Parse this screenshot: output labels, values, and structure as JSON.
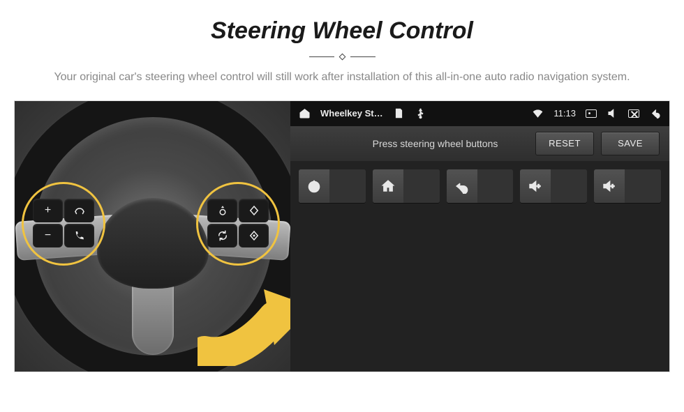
{
  "header": {
    "title": "Steering Wheel Control",
    "subtitle": "Your original car's steering wheel control will still work after installation of this all-in-one auto radio navigation system."
  },
  "wheel": {
    "left_pad_buttons": [
      "plus",
      "voice",
      "minus",
      "phone"
    ],
    "right_pad_buttons": [
      "wheel-up",
      "diamond",
      "cycle",
      "diamond-alt"
    ]
  },
  "statusbar": {
    "app_title": "Wheelkey St…",
    "time": "11:13"
  },
  "toolbar": {
    "instruction": "Press steering wheel buttons",
    "reset_label": "RESET",
    "save_label": "SAVE"
  },
  "tiles": [
    {
      "icon": "power"
    },
    {
      "icon": "home"
    },
    {
      "icon": "undo"
    },
    {
      "icon": "vol-up"
    },
    {
      "icon": "vol-up"
    }
  ]
}
